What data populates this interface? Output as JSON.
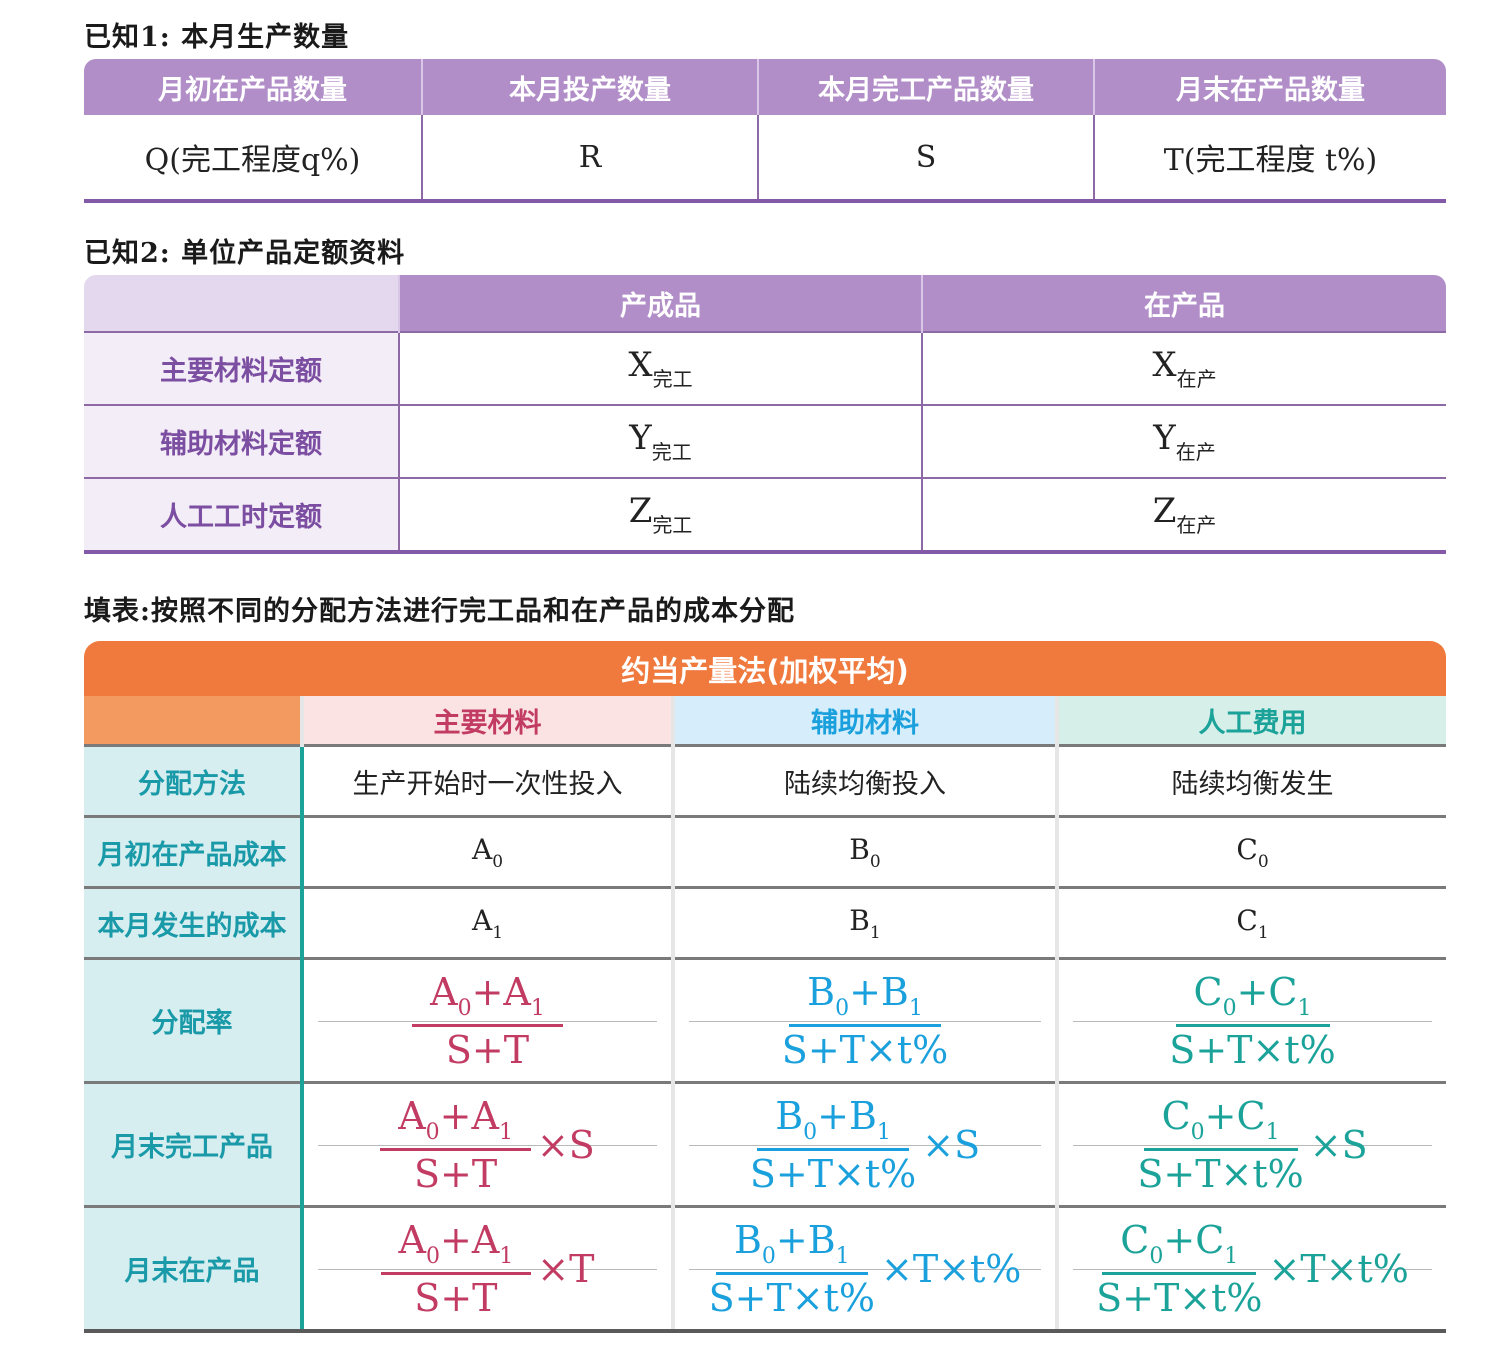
{
  "section1": {
    "heading": "已知1: 本月生产数量",
    "headers": [
      "月初在产品数量",
      "本月投产数量",
      "本月完工产品数量",
      "月末在产品数量"
    ],
    "values": [
      "Q(完工程度q%)",
      "R",
      "S",
      "T(完工程度 t%)"
    ]
  },
  "section2": {
    "heading": "已知2: 单位产品定额资料",
    "headers": [
      "产成品",
      "在产品"
    ],
    "rows": [
      {
        "label": "主要材料定额",
        "fg_base": "X",
        "fg_sub": "完工",
        "wip_base": "X",
        "wip_sub": "在产"
      },
      {
        "label": "辅助材料定额",
        "fg_base": "Y",
        "fg_sub": "完工",
        "wip_base": "Y",
        "wip_sub": "在产"
      },
      {
        "label": "人工工时定额",
        "fg_base": "Z",
        "fg_sub": "完工",
        "wip_base": "Z",
        "wip_sub": "在产"
      }
    ]
  },
  "section3": {
    "heading": "填表:按照不同的分配方法进行完工品和在产品的成本分配",
    "title": "约当产量法(加权平均)",
    "categories": [
      "主要材料",
      "辅助材料",
      "人工费用"
    ],
    "row_labels": [
      "分配方法",
      "月初在产品成本",
      "本月发生的成本",
      "分配率",
      "月末完工产品",
      "月末在产品"
    ],
    "methods": [
      "生产开始时一次性投入",
      "陆续均衡投入",
      "陆续均衡发生"
    ],
    "opening_cost": [
      {
        "base": "A",
        "sub": "0"
      },
      {
        "base": "B",
        "sub": "0"
      },
      {
        "base": "C",
        "sub": "0"
      }
    ],
    "current_cost": [
      {
        "base": "A",
        "sub": "1"
      },
      {
        "base": "B",
        "sub": "1"
      },
      {
        "base": "C",
        "sub": "1"
      }
    ],
    "rate_denominators": [
      "S+T",
      "S+T×t%",
      "S+T×t%"
    ],
    "finished_multiplier": "×S",
    "wip_multipliers": [
      "×T",
      "×T×t%",
      "×T×t%"
    ],
    "colors": {
      "main": "#c23b62",
      "aux": "#1aa0dc",
      "labor": "#1ba39a",
      "title": "#f07a3e",
      "purple": "#b18ec8"
    }
  }
}
